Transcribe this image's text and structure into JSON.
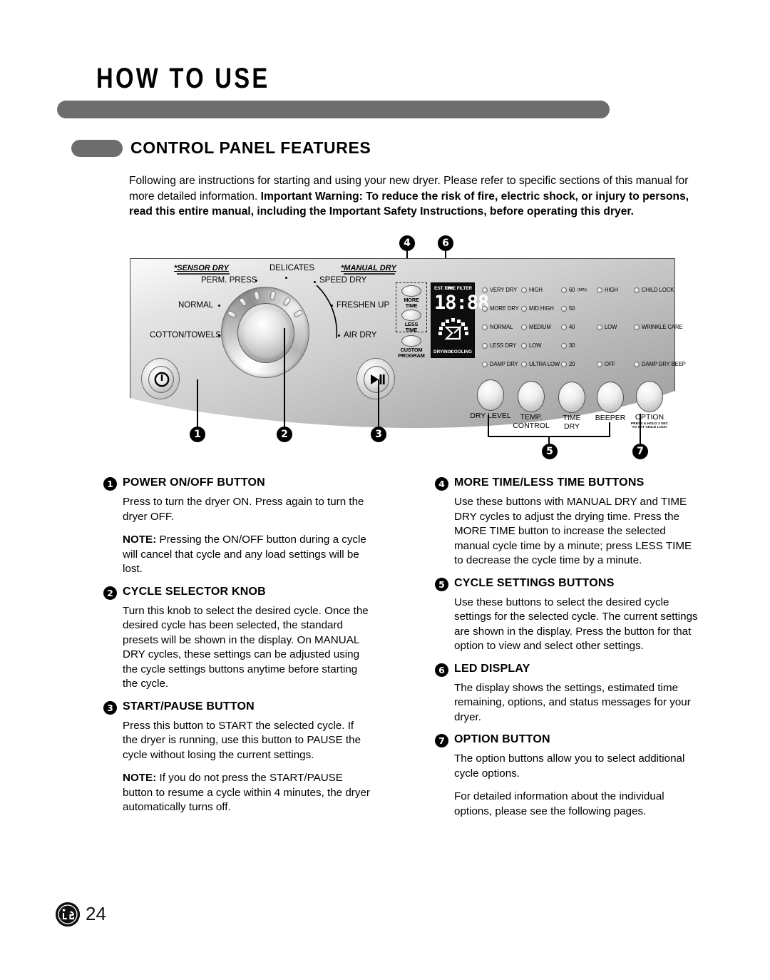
{
  "header": {
    "chapter_title": "HOW TO USE",
    "section_title": "CONTROL PANEL FEATURES"
  },
  "intro": {
    "text_normal_1": "Following are instructions for starting and using your new dryer. Please refer to specific sections of this manual for more detailed information. ",
    "text_bold": "Important Warning: To reduce the risk of fire, electric shock, or injury to persons, read this entire manual, including the Important Safety Instructions, before operating this dryer."
  },
  "panel": {
    "group_sensor_dry": "*SENSOR DRY",
    "group_manual_dry": "*MANUAL DRY",
    "cycles_left": [
      "PERM. PRESS",
      "NORMAL",
      "COTTON/TOWELS"
    ],
    "cycle_top": "DELICATES",
    "cycles_right": [
      "SPEED DRY",
      "FRESHEN UP",
      "AIR DRY"
    ],
    "power_button_icon": "power-icon",
    "start_pause_icon": "play-pause-icon",
    "time_buttons": [
      {
        "label_line1": "MORE",
        "label_line2": "TIME"
      },
      {
        "label_line1": "LESS",
        "label_line2": "TIME"
      }
    ],
    "custom_program": {
      "label_line1": "CUSTOM",
      "label_line2": "PROGRAM"
    },
    "led_display": {
      "est_time_label": "EST. TIME",
      "chk_filter_label": "CHK. FILTER",
      "digits": "18:88",
      "status_drying": "DRYING",
      "status_arrow": ">",
      "status_cooling": "COOLING"
    },
    "indicator_columns": [
      {
        "name": "dry-level",
        "items": [
          "VERY DRY",
          "MORE DRY",
          "NORMAL",
          "LESS DRY",
          "DAMP DRY"
        ]
      },
      {
        "name": "temp-control",
        "items": [
          "HIGH",
          "MID HIGH",
          "MEDIUM",
          "LOW",
          "ULTRA LOW"
        ]
      },
      {
        "name": "time-dry",
        "items": [
          "60",
          "50",
          "40",
          "30",
          "20"
        ],
        "unit_suffix": "(MIN)"
      },
      {
        "name": "beeper",
        "items": [
          "HIGH",
          "",
          "LOW",
          "",
          "OFF"
        ]
      },
      {
        "name": "option",
        "items": [
          "CHILD LOCK",
          "",
          "WRINKLE CARE",
          "",
          "DAMP DRY BEEP"
        ]
      }
    ],
    "cycle_setting_buttons": [
      {
        "line1": "DRY LEVEL",
        "line2": ""
      },
      {
        "line1": "TEMP.",
        "line2": "CONTROL"
      },
      {
        "line1": "TIME",
        "line2": "DRY"
      },
      {
        "line1": "BEEPER",
        "line2": ""
      }
    ],
    "option_button": {
      "line1": "OPTION",
      "sub1": "PRESS & HOLD 3 SEC",
      "sub2": "TO SET CHILD LOCK"
    },
    "callouts": [
      "1",
      "2",
      "3",
      "4",
      "5",
      "6",
      "7"
    ]
  },
  "descriptions": {
    "left": [
      {
        "num": "1",
        "title": "POWER ON/OFF BUTTON",
        "paras": [
          {
            "bold_lead": "",
            "text": "Press to turn the dryer ON. Press again to turn the dryer OFF."
          },
          {
            "bold_lead": "NOTE:",
            "text": " Pressing the ON/OFF button during a cycle will cancel that cycle and any load settings will be lost."
          }
        ]
      },
      {
        "num": "2",
        "title": "CYCLE SELECTOR KNOB",
        "paras": [
          {
            "bold_lead": "",
            "text": "Turn this knob to select the desired cycle. Once the desired cycle has been selected, the standard presets will be shown in the display. On MANUAL DRY cycles, these settings can be adjusted using the cycle settings buttons anytime before starting the cycle."
          }
        ]
      },
      {
        "num": "3",
        "title": "START/PAUSE BUTTON",
        "paras": [
          {
            "bold_lead": "",
            "text": "Press this button to START the selected cycle. If the dryer is running, use this button to PAUSE the cycle without losing the current settings."
          },
          {
            "bold_lead": "NOTE:",
            "text": " If you do not press the START/PAUSE button to resume a cycle within 4 minutes, the dryer automatically turns off."
          }
        ]
      }
    ],
    "right": [
      {
        "num": "4",
        "title": "MORE TIME/LESS TIME BUTTONS",
        "paras": [
          {
            "bold_lead": "",
            "text": "Use these buttons with MANUAL DRY and TIME DRY cycles to adjust the drying time. Press the MORE TIME button to increase the selected manual cycle time by a minute; press LESS TIME to decrease the cycle time by a minute."
          }
        ]
      },
      {
        "num": "5",
        "title": "CYCLE SETTINGS BUTTONS",
        "paras": [
          {
            "bold_lead": "",
            "text": "Use these buttons to select the desired cycle settings for the selected cycle. The current settings are shown in the display. Press the button for that option to view and select other settings."
          }
        ]
      },
      {
        "num": "6",
        "title": "LED DISPLAY",
        "paras": [
          {
            "bold_lead": "",
            "text": "The display shows the settings, estimated time remaining, options, and status messages for your dryer."
          }
        ]
      },
      {
        "num": "7",
        "title": "OPTION BUTTON",
        "paras": [
          {
            "bold_lead": "",
            "text": "The option buttons allow you to select additional cycle options."
          },
          {
            "bold_lead": "",
            "text": "For detailed information about the individual options, please see the following pages."
          }
        ]
      }
    ]
  },
  "footer": {
    "brand": "LG",
    "page_number": "24"
  },
  "colors": {
    "bar_gray": "#6d6d6d",
    "ink": "#000000",
    "panel_light": "#f0f0f0",
    "panel_dark": "#9a9a9a"
  }
}
